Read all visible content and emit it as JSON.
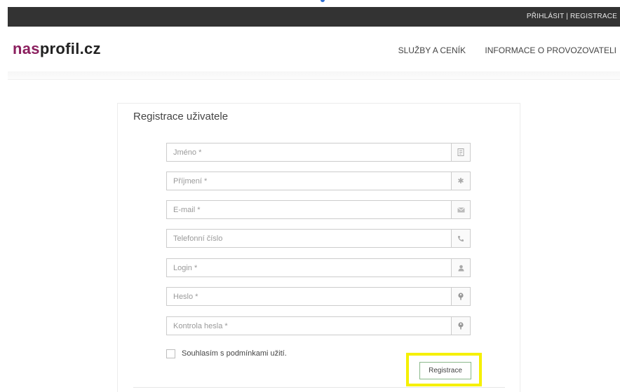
{
  "topbar": {
    "login_links": "PŘIHLÁSIT | REGISTRACE"
  },
  "header": {
    "logo_part1": "nas",
    "logo_part2": "profil.cz",
    "nav": [
      "SLUŽBY A CENÍK",
      "INFORMACE O PROVOZOVATELI"
    ]
  },
  "form": {
    "title": "Registrace uživatele",
    "fields": [
      {
        "placeholder": "Jméno *",
        "icon": "id-card-icon"
      },
      {
        "placeholder": "Příjmení *",
        "icon": "asterisk-icon"
      },
      {
        "placeholder": "E-mail *",
        "icon": "envelope-icon"
      },
      {
        "placeholder": "Telefonní číslo",
        "icon": "phone-icon"
      },
      {
        "placeholder": "Login *",
        "icon": "user-icon"
      },
      {
        "placeholder": "Heslo *",
        "icon": "key-icon"
      },
      {
        "placeholder": "Kontrola hesla *",
        "icon": "key-icon"
      }
    ],
    "terms_label": "Souhlasím s podmínkami užití.",
    "submit_label": "Registrace"
  },
  "colors": {
    "logo_accent": "#8b1f5e",
    "topbar": "#333333",
    "highlight": "#f5f000",
    "button_border": "#8ab98a"
  }
}
